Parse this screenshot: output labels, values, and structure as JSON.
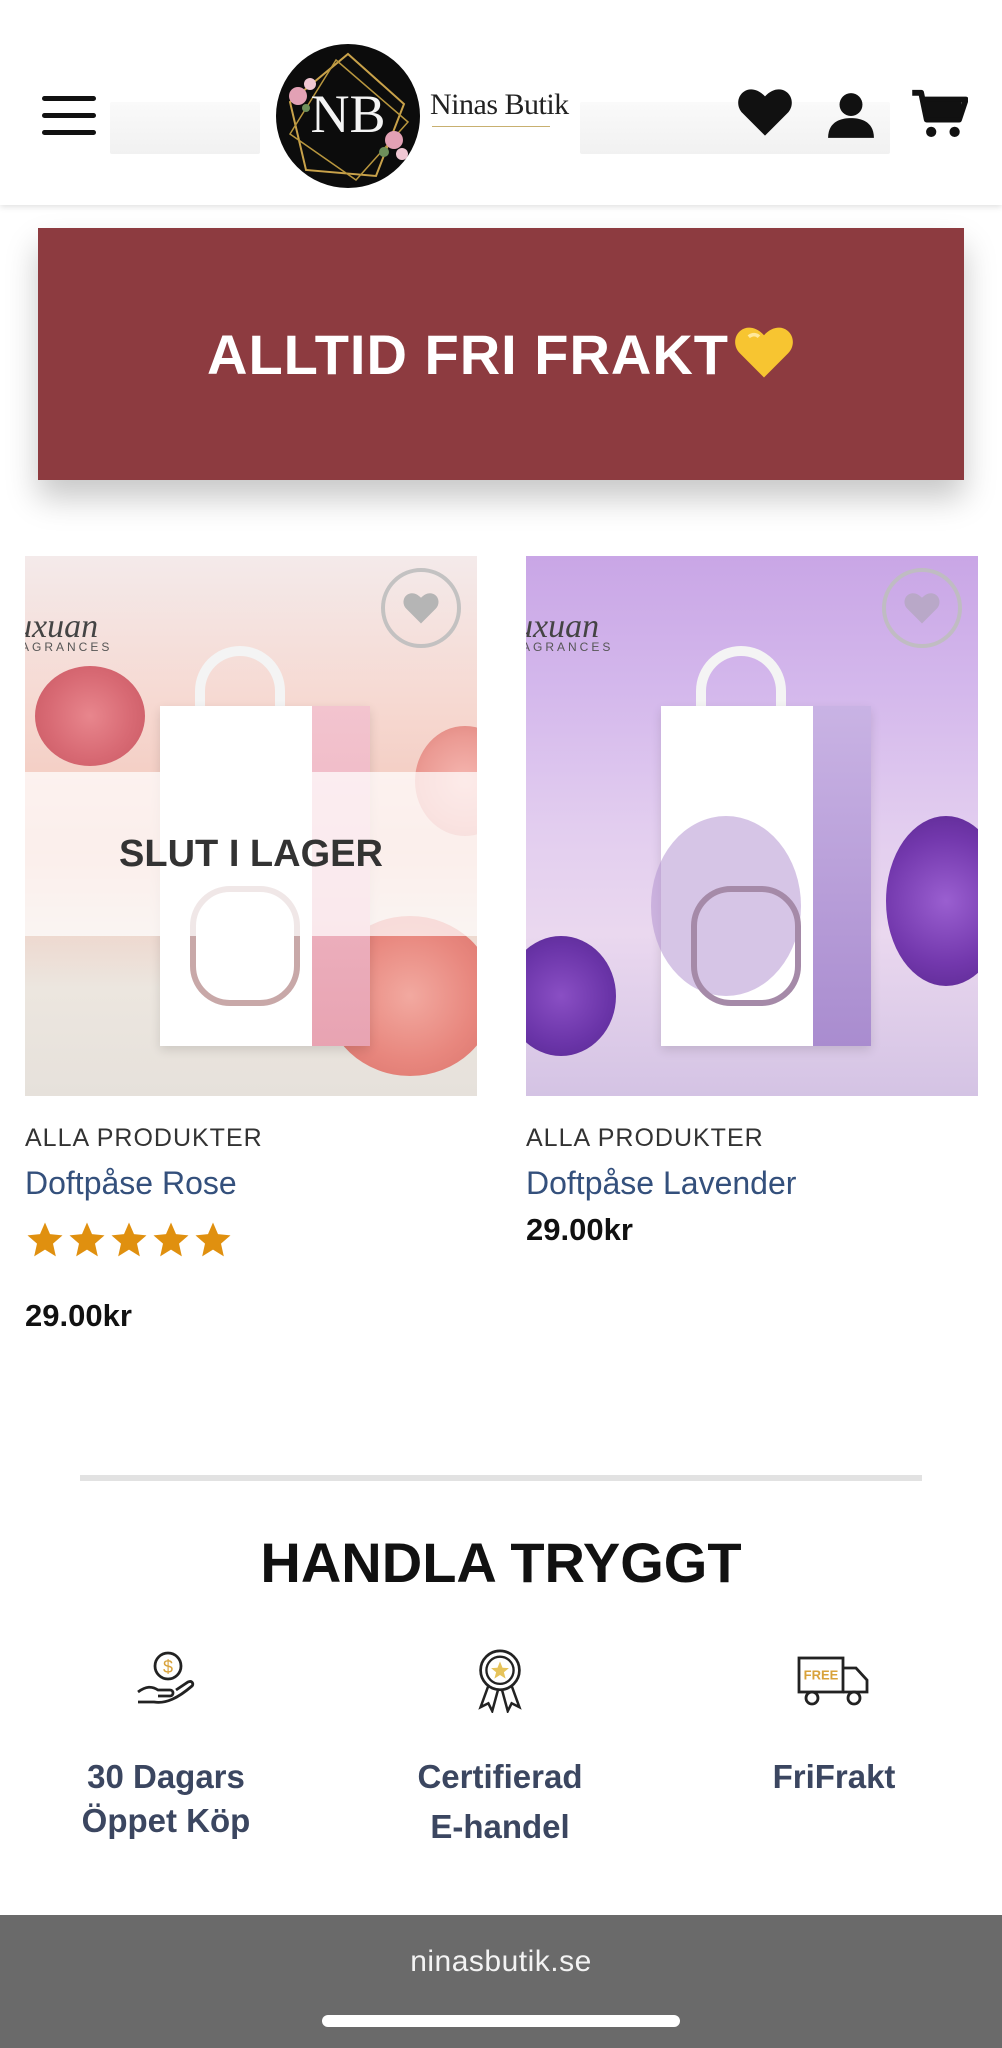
{
  "header": {
    "logo_monogram": "NB",
    "logo_text": "Ninas Butik"
  },
  "banner": {
    "text": "ALLTID FRI FRAKT"
  },
  "products": [
    {
      "category": "ALLA PRODUKTER",
      "name": "Doftpåse Rose",
      "price": "29.00kr",
      "rating": 5,
      "status": "SLUT I LAGER",
      "brand": "uxuan",
      "brand_sub": "AGRANCES"
    },
    {
      "category": "ALLA PRODUKTER",
      "name": "Doftpåse Lavender",
      "price": "29.00kr",
      "brand": "uxuan",
      "brand_sub": "AGRANCES"
    }
  ],
  "trust": {
    "title": "HANDLA TRYGGT",
    "features": [
      {
        "line1": "30 Dagars",
        "line2": "Öppet Köp",
        "icon": "money-hand-icon"
      },
      {
        "line1": "Certifierad",
        "line2": "E-handel",
        "icon": "award-badge-icon"
      },
      {
        "line1": "FriFrakt",
        "line2": "",
        "icon": "free-truck-icon",
        "badge": "FREE"
      }
    ]
  },
  "browser": {
    "url": "ninasbutik.se"
  },
  "colors": {
    "banner": "#8d3b40",
    "star": "#e0900f",
    "product_link": "#34507c",
    "bottom_bar": "#6a6a6a"
  }
}
